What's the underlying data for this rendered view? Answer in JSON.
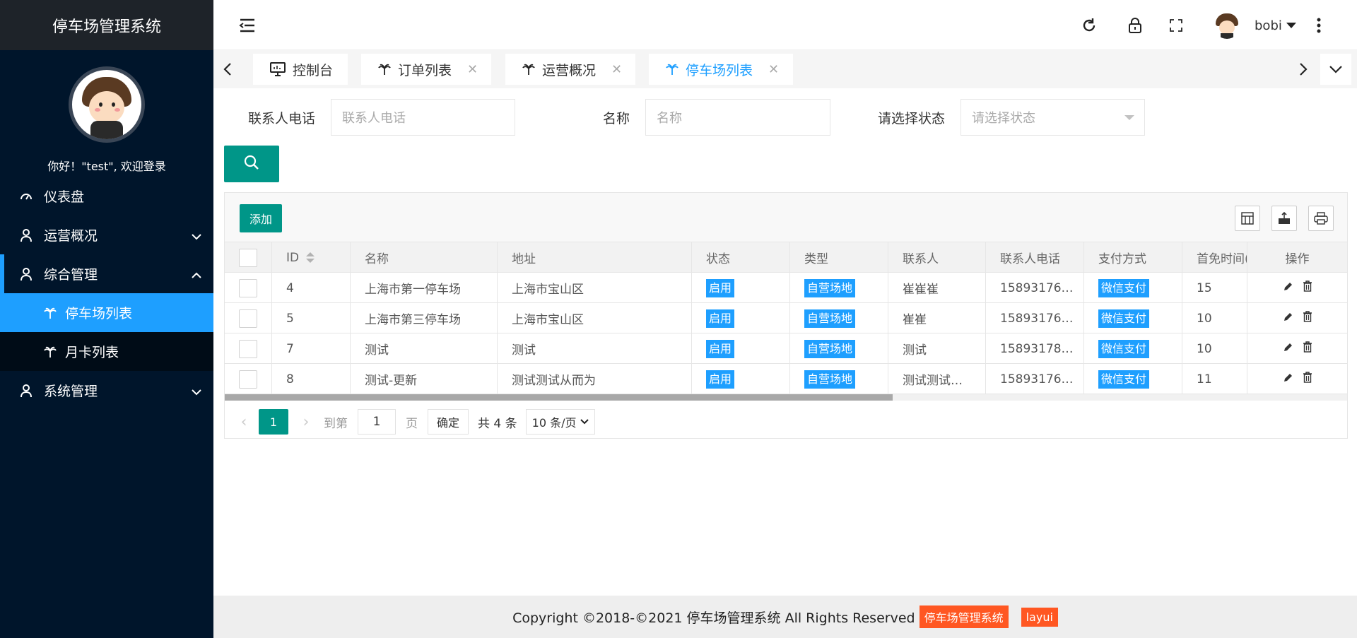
{
  "app": {
    "title": "停车场管理系统"
  },
  "sidebar": {
    "welcome": "你好！\"test\", 欢迎登录",
    "items": [
      {
        "label": "仪表盘",
        "icon": "dashboard-icon"
      },
      {
        "label": "运营概况",
        "icon": "user-icon"
      },
      {
        "label": "综合管理",
        "icon": "user-icon"
      },
      {
        "label": "系统管理",
        "icon": "user-icon"
      }
    ],
    "sub_items": [
      {
        "label": "停车场列表",
        "active": true
      },
      {
        "label": "月卡列表",
        "active": false
      }
    ]
  },
  "header": {
    "username": "bobi"
  },
  "tabs": [
    {
      "label": "控制台",
      "icon": "monitor-icon"
    },
    {
      "label": "订单列表",
      "icon": "palm-icon"
    },
    {
      "label": "运营概况",
      "icon": "palm-icon"
    },
    {
      "label": "停车场列表",
      "icon": "palm-icon",
      "active": true
    }
  ],
  "search": {
    "phone_label": "联系人电话",
    "phone_placeholder": "联系人电话",
    "name_label": "名称",
    "name_placeholder": "名称",
    "status_label": "请选择状态",
    "status_placeholder": "请选择状态"
  },
  "toolbar": {
    "add_label": "添加"
  },
  "table": {
    "columns": [
      "ID",
      "名称",
      "地址",
      "状态",
      "类型",
      "联系人",
      "联系人电话",
      "支付方式",
      "首免时间(",
      "操作"
    ],
    "rows": [
      {
        "id": "4",
        "name": "上海市第一停车场",
        "address": "上海市宝山区",
        "status": "启用",
        "type": "自营场地",
        "contact": "崔崔崔",
        "phone": "15893176…",
        "pay": "微信支付",
        "free": "15"
      },
      {
        "id": "5",
        "name": "上海市第三停车场",
        "address": "上海市宝山区",
        "status": "启用",
        "type": "自营场地",
        "contact": "崔崔",
        "phone": "15893176…",
        "pay": "微信支付",
        "free": "10"
      },
      {
        "id": "7",
        "name": "测试",
        "address": "测试",
        "status": "启用",
        "type": "自营场地",
        "contact": "测试",
        "phone": "15893178…",
        "pay": "微信支付",
        "free": "10"
      },
      {
        "id": "8",
        "name": "测试-更新",
        "address": "测试测试从而为",
        "status": "启用",
        "type": "自营场地",
        "contact": "测试测试…",
        "phone": "15893176…",
        "pay": "微信支付",
        "free": "11"
      }
    ]
  },
  "pager": {
    "current": "1",
    "goto_label": "到第",
    "goto_value": "1",
    "page_label": "页",
    "confirm_label": "确定",
    "total_label": "共 4 条",
    "page_size": "10 条/页"
  },
  "footer": {
    "copyright": "Copyright ©2018-©2021 停车场管理系统 All Rights Reserved",
    "badge1": "停车场管理系统",
    "badge2": "layui"
  },
  "colors": {
    "primary": "#009688",
    "accent": "#1e9fff",
    "sidebar_bg": "#00152b",
    "orange": "#ff5722"
  }
}
